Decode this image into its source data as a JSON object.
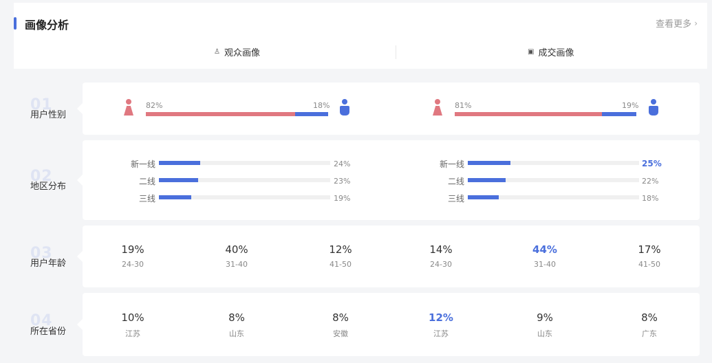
{
  "header": {
    "title": "画像分析",
    "more_label": "查看更多"
  },
  "tabs": [
    {
      "label": "观众画像",
      "icon": "person-icon"
    },
    {
      "label": "成交画像",
      "icon": "receipt-icon"
    }
  ],
  "colors": {
    "accent": "#4a6fdc",
    "female": "#e07880",
    "male": "#4a6fdc"
  },
  "sections": {
    "gender": {
      "num": "01",
      "label": "用户性别",
      "audience": {
        "female": "82%",
        "male": "18%",
        "female_share": 0.82
      },
      "deal": {
        "female": "81%",
        "male": "19%",
        "female_share": 0.81
      }
    },
    "region": {
      "num": "02",
      "label": "地区分布",
      "audience": [
        {
          "label": "新一线",
          "value": "24%",
          "share": 0.24
        },
        {
          "label": "二线",
          "value": "23%",
          "share": 0.23
        },
        {
          "label": "三线",
          "value": "19%",
          "share": 0.19
        }
      ],
      "deal": [
        {
          "label": "新一线",
          "value": "25%",
          "share": 0.25,
          "highlight": true
        },
        {
          "label": "二线",
          "value": "22%",
          "share": 0.22
        },
        {
          "label": "三线",
          "value": "18%",
          "share": 0.18
        }
      ]
    },
    "age": {
      "num": "03",
      "label": "用户年龄",
      "items": [
        {
          "value": "19%",
          "label": "24-30"
        },
        {
          "value": "40%",
          "label": "31-40"
        },
        {
          "value": "12%",
          "label": "41-50"
        },
        {
          "value": "14%",
          "label": "24-30"
        },
        {
          "value": "44%",
          "label": "31-40",
          "highlight": true
        },
        {
          "value": "17%",
          "label": "41-50"
        }
      ]
    },
    "province": {
      "num": "04",
      "label": "所在省份",
      "items": [
        {
          "value": "10%",
          "label": "江苏"
        },
        {
          "value": "8%",
          "label": "山东"
        },
        {
          "value": "8%",
          "label": "安徽"
        },
        {
          "value": "12%",
          "label": "江苏",
          "highlight": true
        },
        {
          "value": "9%",
          "label": "山东"
        },
        {
          "value": "8%",
          "label": "广东"
        }
      ]
    }
  }
}
